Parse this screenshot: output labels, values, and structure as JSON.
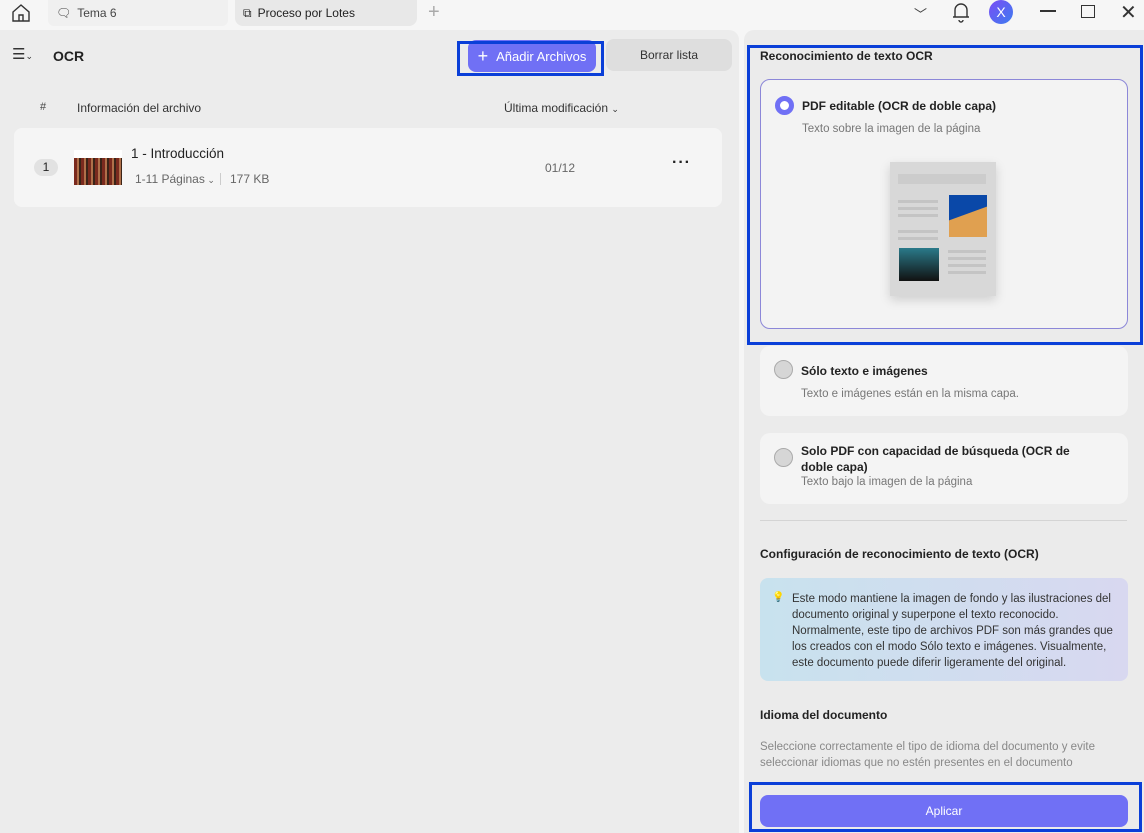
{
  "titlebar": {
    "tabs": [
      {
        "label": "Tema 6",
        "icon": "comment-icon"
      },
      {
        "label": "Proceso por Lotes",
        "icon": "copy-icon"
      }
    ],
    "avatar": "X",
    "accent": "#7070f5"
  },
  "left": {
    "title": "OCR",
    "add_button": "Añadir Archivos",
    "clear_button": "Borrar lista",
    "columns": {
      "num": "#",
      "info": "Información del archivo",
      "modified": "Última modificación"
    },
    "files": [
      {
        "index": "1",
        "name": "1 - Introducción",
        "pages": "1-11 Páginas",
        "size": "177 KB",
        "date": "01/12"
      }
    ]
  },
  "right": {
    "section_title": "Reconocimiento de texto OCR",
    "options": [
      {
        "title": "PDF editable (OCR de doble capa)",
        "subtitle": "Texto sobre la imagen de la página",
        "selected": true
      },
      {
        "title": "Sólo texto e imágenes",
        "subtitle": "Texto e imágenes están en la misma capa.",
        "selected": false
      },
      {
        "title": "Solo PDF con capacidad de búsqueda (OCR de doble capa)",
        "subtitle": "Texto bajo la imagen de la página",
        "selected": false
      }
    ],
    "config_title": "Configuración de reconocimiento de texto (OCR)",
    "info_text": "Este modo mantiene la imagen de fondo y las ilustraciones del documento original y superpone el texto reconocido. Normalmente, este tipo de archivos PDF son más grandes que los creados con el modo Sólo texto e imágenes. Visualmente, este documento puede diferir ligeramente del original.",
    "language_title": "Idioma del documento",
    "language_help": "Seleccione correctamente el tipo de idioma del documento y evite seleccionar idiomas que no estén presentes en el documento",
    "apply_button": "Aplicar"
  }
}
